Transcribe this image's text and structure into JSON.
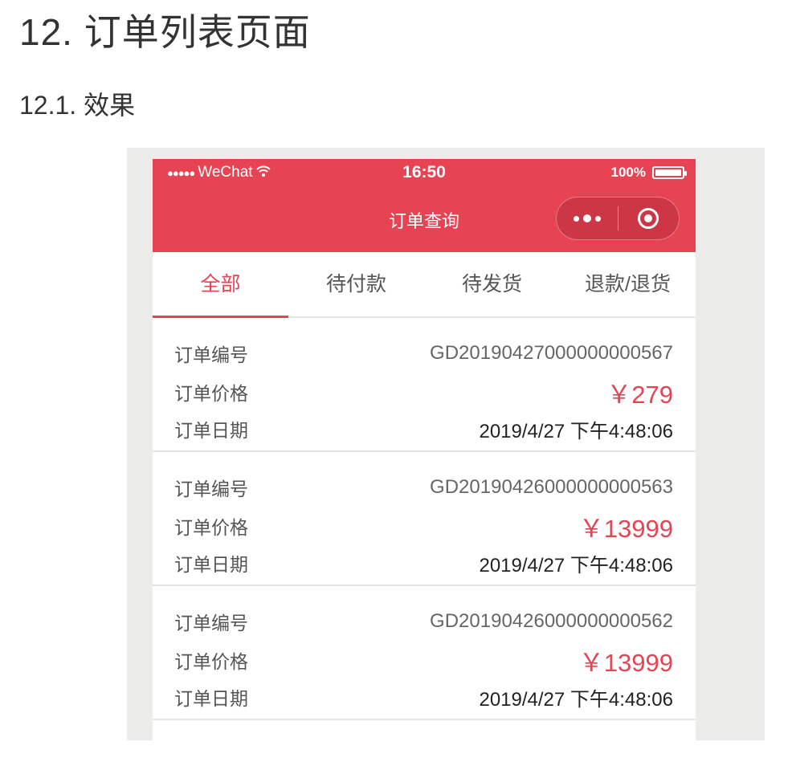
{
  "doc": {
    "heading": "12. 订单列表页面",
    "subheading": "12.1. 效果"
  },
  "statusbar": {
    "signal": "●●●●●",
    "carrier": "WeChat",
    "time": "16:50",
    "battery_text": "100%",
    "battery_level": 1.0
  },
  "navbar": {
    "title": "订单查询"
  },
  "tabs": [
    {
      "label": "全部",
      "active": true
    },
    {
      "label": "待付款",
      "active": false
    },
    {
      "label": "待发货",
      "active": false
    },
    {
      "label": "退款/退货",
      "active": false
    }
  ],
  "orders": [
    {
      "no_label": "订单编号",
      "no": "GD20190427000000000567",
      "price_label": "订单价格",
      "price": "￥279",
      "date_label": "订单日期",
      "date": "2019/4/27 下午4:48:06"
    },
    {
      "no_label": "订单编号",
      "no": "GD20190426000000000563",
      "price_label": "订单价格",
      "price": "￥13999",
      "date_label": "订单日期",
      "date": "2019/4/27 下午4:48:06"
    },
    {
      "no_label": "订单编号",
      "no": "GD20190426000000000562",
      "price_label": "订单价格",
      "price": "￥13999",
      "date_label": "订单日期",
      "date": "2019/4/27 下午4:48:06"
    }
  ],
  "colors": {
    "brand": "#e64453",
    "page_bg": "#ececea"
  },
  "icons": [
    "wifi-icon",
    "battery-icon",
    "more-dots-icon",
    "close-target-icon"
  ]
}
